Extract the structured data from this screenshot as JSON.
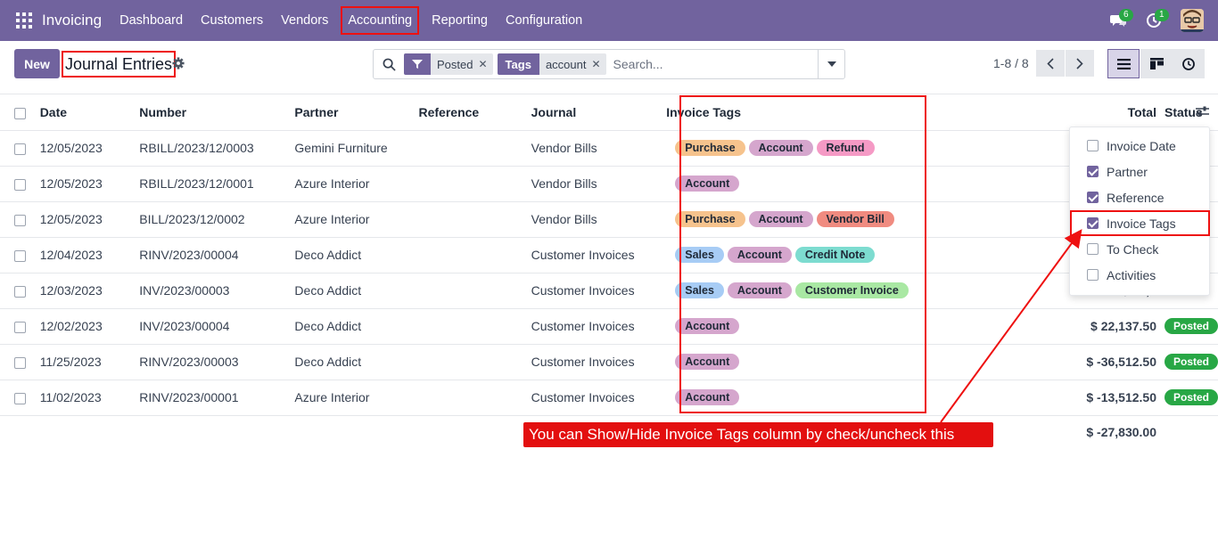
{
  "topbar": {
    "app_name": "Invoicing",
    "menu": [
      "Dashboard",
      "Customers",
      "Vendors",
      "Accounting",
      "Reporting",
      "Configuration"
    ],
    "messages_count": "6",
    "activities_count": "1"
  },
  "control": {
    "new_label": "New",
    "title": "Journal Entries",
    "facets": [
      {
        "label": "",
        "value": "Posted"
      },
      {
        "label": "Tags",
        "value": "account"
      }
    ],
    "search_placeholder": "Search...",
    "pager": "1-8 / 8"
  },
  "table": {
    "headers": [
      "Date",
      "Number",
      "Partner",
      "Reference",
      "Journal",
      "Invoice Tags",
      "Total",
      "Status"
    ],
    "rows": [
      {
        "date": "12/05/2023",
        "number": "RBILL/2023/12/0003",
        "partner": "Gemini Furniture",
        "journal": "Vendor Bills",
        "tags": [
          "Purchase",
          "Account",
          "Refund"
        ],
        "total": "$ 3",
        "status": ""
      },
      {
        "date": "12/05/2023",
        "number": "RBILL/2023/12/0001",
        "partner": "Azure Interior",
        "journal": "Vendor Bills",
        "tags": [
          "Account"
        ],
        "total": "$ 3",
        "status": ""
      },
      {
        "date": "12/05/2023",
        "number": "BILL/2023/12/0002",
        "partner": "Azure Interior",
        "journal": "Vendor Bills",
        "tags": [
          "Purchase",
          "Account",
          "Vendor Bill"
        ],
        "total": "$ -",
        "status": ""
      },
      {
        "date": "12/04/2023",
        "number": "RINV/2023/00004",
        "partner": "Deco Addict",
        "journal": "Customer Invoices",
        "tags": [
          "Sales",
          "Account",
          "Credit Note"
        ],
        "total": "$ -48,0",
        "status": ""
      },
      {
        "date": "12/03/2023",
        "number": "INV/2023/00003",
        "partner": "Deco Addict",
        "journal": "Customer Invoices",
        "tags": [
          "Sales",
          "Account",
          "Customer Invoice"
        ],
        "total": "$ 48,0",
        "status": ""
      },
      {
        "date": "12/02/2023",
        "number": "INV/2023/00004",
        "partner": "Deco Addict",
        "journal": "Customer Invoices",
        "tags": [
          "Account"
        ],
        "total": "$ 22,137.50",
        "status": "Posted"
      },
      {
        "date": "11/25/2023",
        "number": "RINV/2023/00003",
        "partner": "Deco Addict",
        "journal": "Customer Invoices",
        "tags": [
          "Account"
        ],
        "total": "$ -36,512.50",
        "status": "Posted"
      },
      {
        "date": "11/02/2023",
        "number": "RINV/2023/00001",
        "partner": "Azure Interior",
        "journal": "Customer Invoices",
        "tags": [
          "Account"
        ],
        "total": "$ -13,512.50",
        "status": "Posted"
      }
    ],
    "grand_total": "$ -27,830.00"
  },
  "column_options": [
    {
      "label": "Invoice Date",
      "checked": false
    },
    {
      "label": "Partner",
      "checked": true
    },
    {
      "label": "Reference",
      "checked": true
    },
    {
      "label": "Invoice Tags",
      "checked": true
    },
    {
      "label": "To Check",
      "checked": false
    },
    {
      "label": "Activities",
      "checked": false
    }
  ],
  "callout": "You can Show/Hide Invoice Tags column by check/uncheck this",
  "colors": {
    "brand": "#71639e",
    "highlight": "#e11111",
    "posted": "#28a745"
  }
}
